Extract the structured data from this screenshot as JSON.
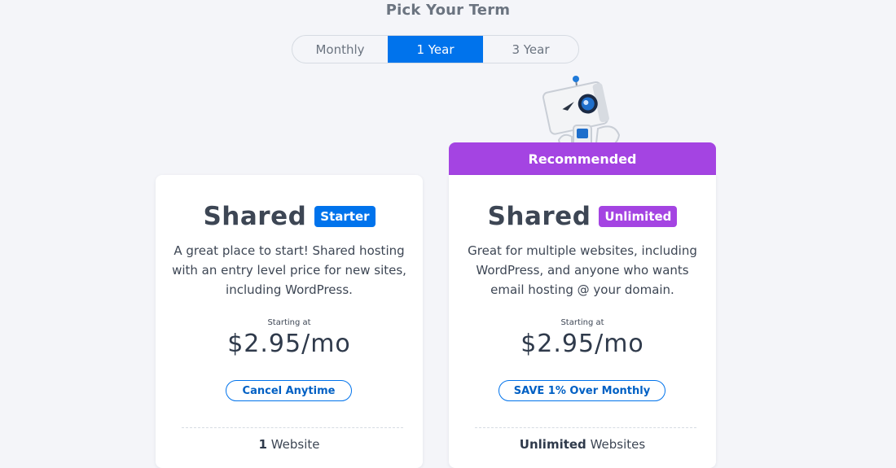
{
  "heading": "Pick Your Term",
  "terms": [
    {
      "label": "Monthly",
      "active": false
    },
    {
      "label": "1 Year",
      "active": true
    },
    {
      "label": "3 Year",
      "active": false
    }
  ],
  "colors": {
    "accent_blue": "#0073ec",
    "recommended_purple": "#a444e2",
    "background": "#f4f5f9"
  },
  "recommended_label": "Recommended",
  "mascot_icon": "robot-mascot-icon",
  "plans": [
    {
      "name": "Shared",
      "badge": "Starter",
      "badge_color": "#0073ec",
      "description": "A great place to start! Shared hosting with an entry level price for new sites, including WordPress.",
      "starting_label": "Starting at",
      "price": "$2.95/mo",
      "pill_label": "Cancel Anytime",
      "feature_bold": "1",
      "feature_text": " Website"
    },
    {
      "name": "Shared",
      "badge": "Unlimited",
      "badge_color": "#a444e2",
      "description": "Great for multiple websites, including WordPress, and anyone who wants email hosting @ your domain.",
      "starting_label": "Starting at",
      "price": "$2.95/mo",
      "pill_label": "SAVE 1% Over Monthly",
      "feature_bold": "Unlimited",
      "feature_text": " Websites"
    }
  ]
}
